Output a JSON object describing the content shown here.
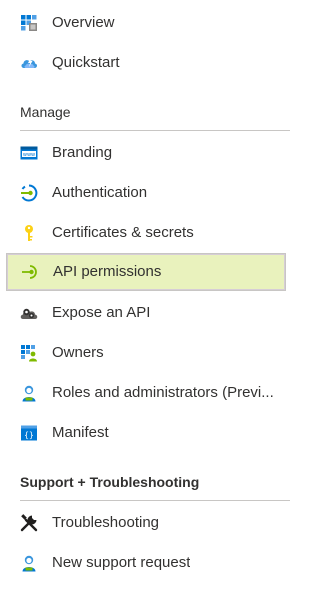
{
  "nav": {
    "top_items": [
      {
        "label": "Overview",
        "icon": "overview-grid-icon"
      },
      {
        "label": "Quickstart",
        "icon": "cloud-quickstart-icon"
      }
    ],
    "manage": {
      "header": "Manage",
      "items": [
        {
          "label": "Branding",
          "icon": "branding-www-icon"
        },
        {
          "label": "Authentication",
          "icon": "authentication-icon"
        },
        {
          "label": "Certificates & secrets",
          "icon": "key-icon"
        },
        {
          "label": "API permissions",
          "icon": "api-permissions-icon",
          "selected": true
        },
        {
          "label": "Expose an API",
          "icon": "gear-cloud-icon"
        },
        {
          "label": "Owners",
          "icon": "owners-icon"
        },
        {
          "label": "Roles and administrators (Previ...",
          "icon": "roles-user-icon"
        },
        {
          "label": "Manifest",
          "icon": "manifest-icon"
        }
      ]
    },
    "support": {
      "header": "Support + Troubleshooting",
      "items": [
        {
          "label": "Troubleshooting",
          "icon": "wrench-screwdriver-icon"
        },
        {
          "label": "New support request",
          "icon": "support-user-icon"
        }
      ]
    }
  },
  "colors": {
    "selected_bg": "#e9f2bd",
    "text": "#323130",
    "accent_blue": "#0078d4",
    "accent_green": "#7fba00"
  }
}
